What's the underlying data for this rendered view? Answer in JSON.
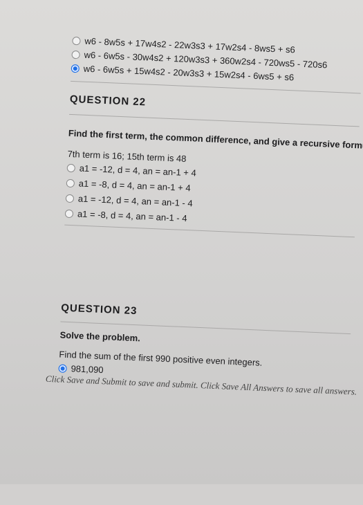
{
  "q21": {
    "options": [
      "w6 - 8w5s + 17w4s2 - 22w3s3 + 17w2s4 - 8ws5 + s6",
      "w6 - 6w5s - 30w4s2 + 120w3s3 + 360w2s4 - 720ws5 - 720s6",
      "w6 - 6w5s + 15w4s2 - 20w3s3 + 15w2s4 - 6ws5 + s6"
    ],
    "selected_index": 2
  },
  "q22": {
    "heading": "QUESTION 22",
    "prompt": "Find the first term, the common difference, and give a recursive formula for the arithmetic sequence.",
    "given": "7th term is 16; 15th term is 48",
    "options": [
      "a1 = -12, d = 4, an = an-1 + 4",
      "a1 = -8, d = 4, an = an-1 + 4",
      "a1 = -12, d = 4, an = an-1 - 4",
      "a1 = -8, d = 4, an = an-1 - 4"
    ]
  },
  "q23": {
    "heading": "QUESTION 23",
    "instruction": "Solve the problem.",
    "prompt": "Find the sum of the first 990 positive even integers.",
    "partial_option": "981,090"
  },
  "footer": "Click Save and Submit to save and submit. Click Save All Answers to save all answers."
}
